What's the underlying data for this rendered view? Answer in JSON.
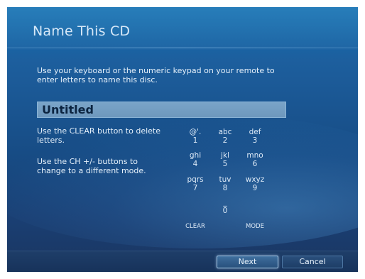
{
  "window": {
    "title": "Name This CD"
  },
  "instructions": "Use your keyboard or the numeric keypad on your remote to enter letters to name this disc.",
  "name_field": {
    "value": "Untitled"
  },
  "help": {
    "clear_text": "Use the CLEAR button to delete letters.",
    "mode_text": "Use the CH +/- buttons to change to a different mode."
  },
  "keypad": {
    "keys": [
      {
        "letters": "@'.",
        "digit": "1"
      },
      {
        "letters": "abc",
        "digit": "2"
      },
      {
        "letters": "def",
        "digit": "3"
      },
      {
        "letters": "ghi",
        "digit": "4"
      },
      {
        "letters": "jkl",
        "digit": "5"
      },
      {
        "letters": "mno",
        "digit": "6"
      },
      {
        "letters": "pqrs",
        "digit": "7"
      },
      {
        "letters": "tuv",
        "digit": "8"
      },
      {
        "letters": "wxyz",
        "digit": "9"
      },
      {
        "letters": "_",
        "digit": "0"
      }
    ],
    "clear_label": "CLEAR",
    "mode_label": "MODE"
  },
  "buttons": {
    "next": "Next",
    "cancel": "Cancel"
  },
  "colors": {
    "background_top": "#0f6fb2",
    "background_bottom": "#1b3560",
    "name_field_bg": "#7aa4c8",
    "text": "#e5f0fa"
  }
}
